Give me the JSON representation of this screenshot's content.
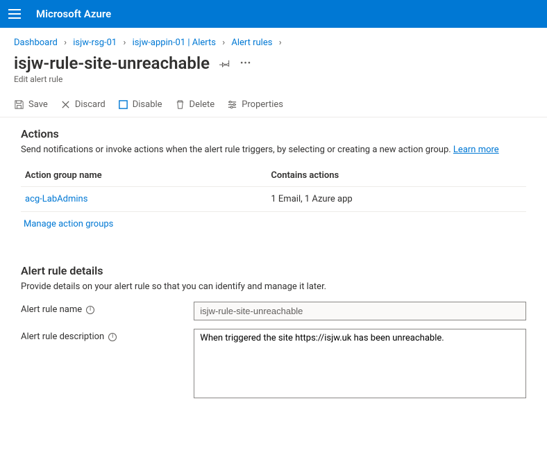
{
  "brand": "Microsoft Azure",
  "breadcrumbs": [
    {
      "label": "Dashboard"
    },
    {
      "label": "isjw-rsg-01"
    },
    {
      "label": "isjw-appin-01 | Alerts"
    },
    {
      "label": "Alert rules"
    }
  ],
  "page": {
    "title": "isjw-rule-site-unreachable",
    "subtitle": "Edit alert rule"
  },
  "toolbar": {
    "save": "Save",
    "discard": "Discard",
    "disable": "Disable",
    "delete": "Delete",
    "properties": "Properties"
  },
  "actions": {
    "heading": "Actions",
    "description": "Send notifications or invoke actions when the alert rule triggers, by selecting or creating a new action group.",
    "learn_more": "Learn more",
    "col_name": "Action group name",
    "col_contains": "Contains actions",
    "rows": [
      {
        "name": "acg-LabAdmins",
        "contains": "1 Email, 1 Azure app"
      }
    ],
    "manage": "Manage action groups"
  },
  "details": {
    "heading": "Alert rule details",
    "description": "Provide details on your alert rule so that you can identify and manage it later.",
    "name_label": "Alert rule name",
    "name_value": "isjw-rule-site-unreachable",
    "desc_label": "Alert rule description",
    "desc_value": "When triggered the site https://isjw.uk has been unreachable."
  }
}
